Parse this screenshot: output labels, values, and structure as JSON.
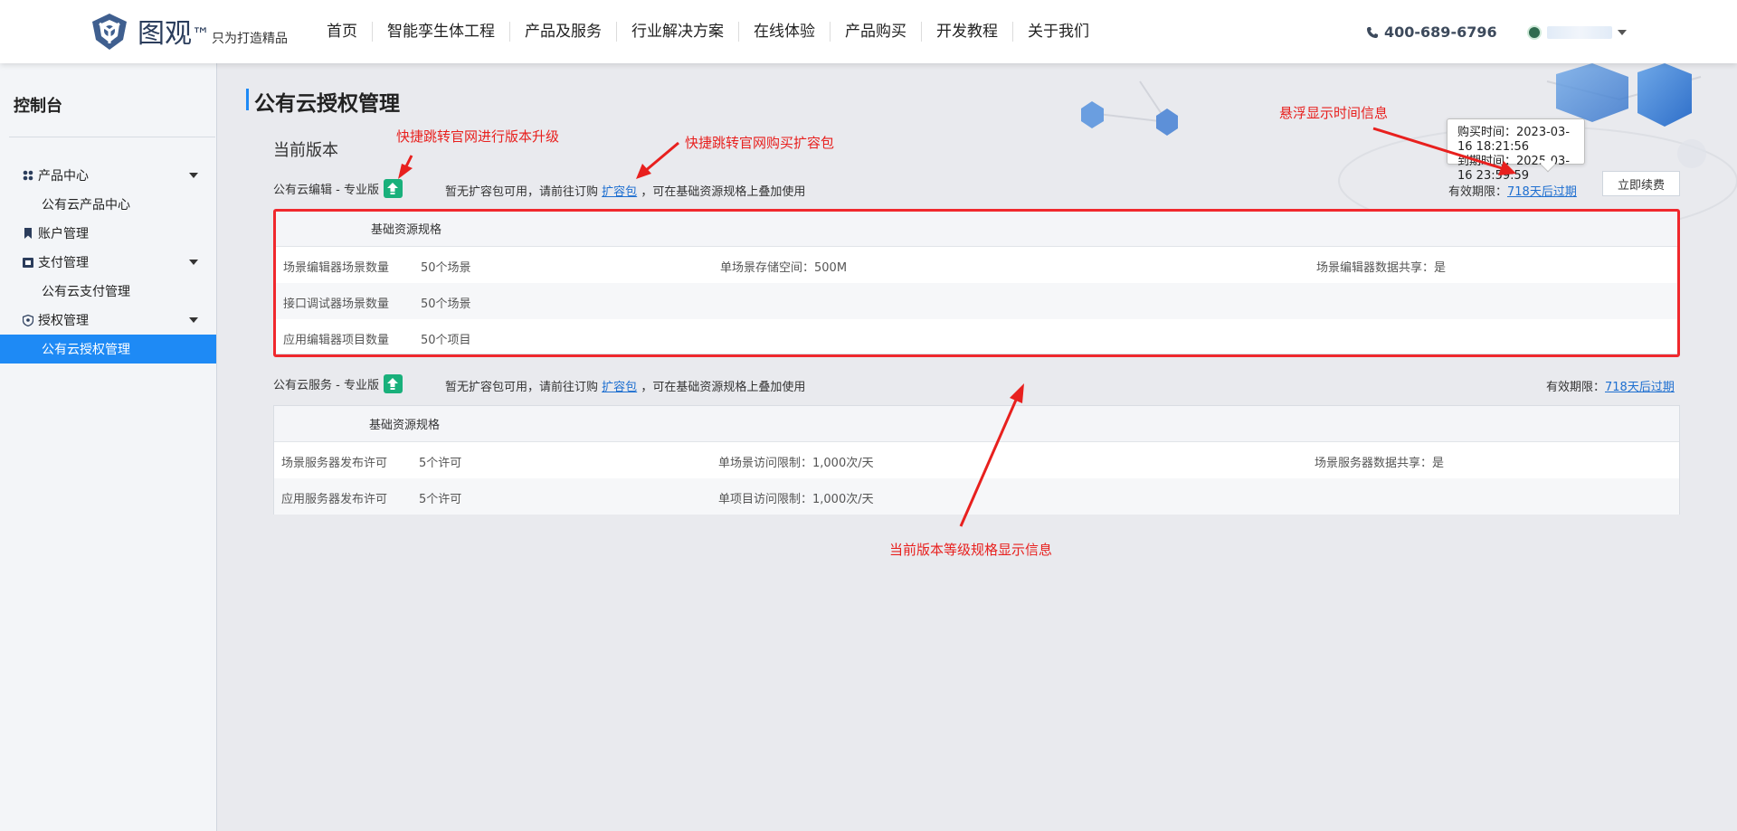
{
  "header": {
    "logo_text": "图观",
    "logo_tm": "™",
    "slogan": "只为打造精品",
    "nav": [
      "首页",
      "智能孪生体工程",
      "产品及服务",
      "行业解决方案",
      "在线体验",
      "产品购买",
      "开发教程",
      "关于我们"
    ],
    "phone": "400-689-6796"
  },
  "sidebar": {
    "title": "控制台",
    "items": [
      {
        "label": "产品中心",
        "icon": "grid-icon",
        "expandable": true
      },
      {
        "label": "公有云产品中心",
        "sub": true
      },
      {
        "label": "账户管理",
        "icon": "bookmark-icon"
      },
      {
        "label": "支付管理",
        "icon": "ticket-icon",
        "expandable": true
      },
      {
        "label": "公有云支付管理",
        "sub": true
      },
      {
        "label": "授权管理",
        "icon": "shield-icon",
        "expandable": true
      },
      {
        "label": "公有云授权管理",
        "sub": true,
        "active": true
      }
    ]
  },
  "main": {
    "title": "公有云授权管理",
    "section_title": "当前版本",
    "editor": {
      "name": "公有云编辑 - 专业版",
      "notice_prefix": "暂无扩容包可用，请前往订购",
      "notice_link": "扩容包",
      "notice_suffix": "，可在基础资源规格上叠加使用",
      "validity_label": "有效期限：",
      "validity_link": "718天后过期",
      "renew_label": "立即续费",
      "spec_header": "基础资源规格",
      "rows": [
        {
          "c1": "场景编辑器场景数量",
          "c2": "50个场景",
          "c3": "单场景存储空间：500M",
          "c4": "场景编辑器数据共享：是"
        },
        {
          "c1": "接口调试器场景数量",
          "c2": "50个场景",
          "c3": "",
          "c4": ""
        },
        {
          "c1": "应用编辑器项目数量",
          "c2": "50个项目",
          "c3": "",
          "c4": ""
        }
      ]
    },
    "service": {
      "name": "公有云服务 - 专业版",
      "notice_prefix": "暂无扩容包可用，请前往订购",
      "notice_link": "扩容包",
      "notice_suffix": "，可在基础资源规格上叠加使用",
      "validity_label": "有效期限：",
      "validity_link": "718天后过期",
      "spec_header": "基础资源规格",
      "rows": [
        {
          "c1": "场景服务器发布许可",
          "c2": "5个许可",
          "c3": "单场景访问限制：1,000次/天",
          "c4": "场景服务器数据共享：是"
        },
        {
          "c1": "应用服务器发布许可",
          "c2": "5个许可",
          "c3": "单项目访问限制：1,000次/天",
          "c4": ""
        }
      ]
    },
    "tooltip": {
      "purchase": "购买时间：2023-03-16 18:21:56",
      "expire": "到期时间：2025-03-16 23:59:59"
    }
  },
  "annotations": {
    "upgrade": "快捷跳转官网进行版本升级",
    "buy_pack": "快捷跳转官网购买扩容包",
    "hover_time": "悬浮显示时间信息",
    "spec_info": "当前版本等级规格显示信息"
  },
  "colors": {
    "accent": "#1e8af5",
    "upgrade_green": "#19b07b",
    "annotation_red": "#e8201e",
    "link_blue": "#1e6fd0"
  }
}
